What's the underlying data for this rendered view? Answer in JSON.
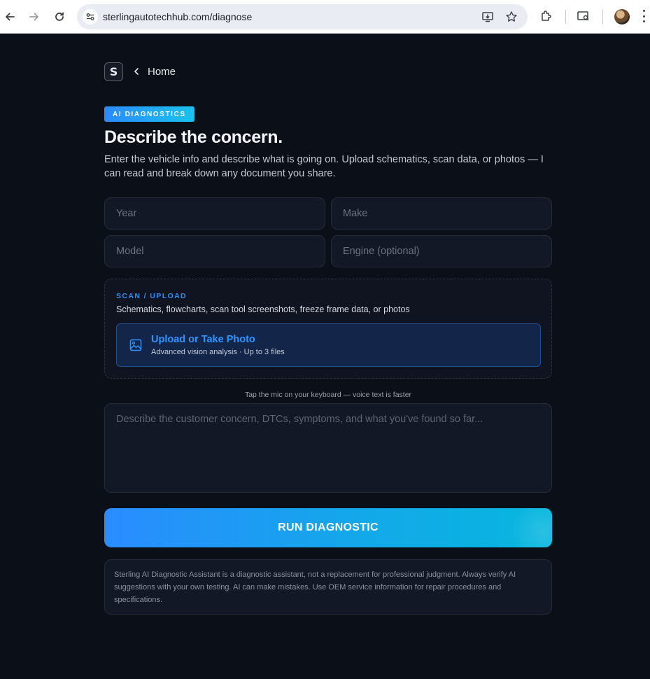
{
  "browser": {
    "url": "sterlingautotechhub.com/diagnose"
  },
  "nav": {
    "logo_text": "S",
    "home_label": "Home"
  },
  "hero": {
    "badge": "AI DIAGNOSTICS",
    "title": "Describe the concern.",
    "subtitle": "Enter the vehicle info and describe what is going on. Upload schematics, scan data, or photos — I can read and break down any document you share."
  },
  "vehicle": {
    "year_placeholder": "Year",
    "make_placeholder": "Make",
    "model_placeholder": "Model",
    "engine_placeholder": "Engine (optional)"
  },
  "upload": {
    "section_label": "SCAN / UPLOAD",
    "description": "Schematics, flowcharts, scan tool screenshots, freeze frame data, or photos",
    "button_title": "Upload or Take Photo",
    "button_subtitle": "Advanced vision analysis · Up to 3 files"
  },
  "concern": {
    "voice_hint": "Tap the mic on your keyboard — voice text is faster",
    "placeholder": "Describe the customer concern, DTCs, symptoms, and what you've found so far..."
  },
  "actions": {
    "run_label": "RUN DIAGNOSTIC"
  },
  "footer": {
    "disclaimer": "Sterling AI Diagnostic Assistant is a diagnostic assistant, not a replacement for professional judgment. Always verify AI suggestions with your own testing. AI can make mistakes. Use OEM service information for repair procedures and specifications."
  },
  "colors": {
    "background": "#0b0f17",
    "accent": "#2f94ff",
    "badge_gradient_start": "#2b8bff",
    "badge_gradient_end": "#19c3ec"
  }
}
